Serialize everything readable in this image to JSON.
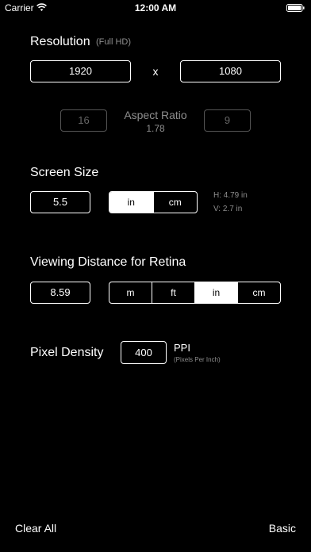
{
  "status_bar": {
    "carrier": "Carrier",
    "time": "12:00 AM"
  },
  "resolution": {
    "label": "Resolution",
    "sub_label": "(Full HD)",
    "width": "1920",
    "separator": "x",
    "height": "1080"
  },
  "aspect_ratio": {
    "left": "16",
    "label": "Aspect Ratio",
    "value": "1.78",
    "right": "9"
  },
  "screen_size": {
    "label": "Screen Size",
    "value": "5.5",
    "units": [
      "in",
      "cm"
    ],
    "selected_unit": "in",
    "h_dimension": "H: 4.79 in",
    "v_dimension": "V: 2.7 in"
  },
  "viewing_distance": {
    "label": "Viewing Distance for Retina",
    "value": "8.59",
    "units": [
      "m",
      "ft",
      "in",
      "cm"
    ],
    "selected_unit": "in"
  },
  "pixel_density": {
    "label": "Pixel Density",
    "value": "400",
    "unit": "PPI",
    "unit_desc": "(Pixels Per Inch)"
  },
  "toolbar": {
    "clear_all": "Clear All",
    "basic": "Basic"
  },
  "colors": {
    "background": "#000000",
    "foreground": "#ffffff",
    "muted": "#8e8e8e"
  }
}
